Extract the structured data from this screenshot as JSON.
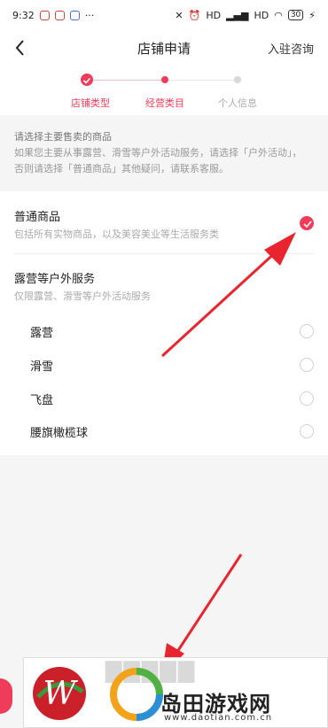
{
  "status_bar": {
    "time": "9:32",
    "signal": "HD",
    "signal2": "HD",
    "battery": "30"
  },
  "nav": {
    "title": "店铺申请",
    "right_link": "入驻咨询"
  },
  "steps": [
    {
      "label": "店铺类型",
      "state": "done"
    },
    {
      "label": "经营类目",
      "state": "current"
    },
    {
      "label": "个人信息",
      "state": "todo"
    }
  ],
  "hint": {
    "title": "请选择主要售卖的商品",
    "line1": "如果您主要从事露营、滑雪等户外活动服务，请选择「户外活动」，",
    "line2": "否则请选择「普通商品」其他疑问，请联系客服。"
  },
  "options": {
    "general": {
      "title": "普通商品",
      "desc": "包括所有实物商品，以及美容美业等生活服务类",
      "checked": true
    },
    "outdoor": {
      "title": "露营等户外服务",
      "desc": "仅限露营、滑雪等户外活动服务",
      "items": [
        {
          "label": "露营",
          "checked": false
        },
        {
          "label": "滑雪",
          "checked": false
        },
        {
          "label": "飞盘",
          "checked": false
        },
        {
          "label": "腰旗橄榄球",
          "checked": false
        }
      ]
    }
  },
  "watermark": {
    "name": "岛田游戏网",
    "url": "www.daotian.com.cn"
  },
  "colors": {
    "accent": "#ef3c5a",
    "arrow": "#e8252f"
  }
}
